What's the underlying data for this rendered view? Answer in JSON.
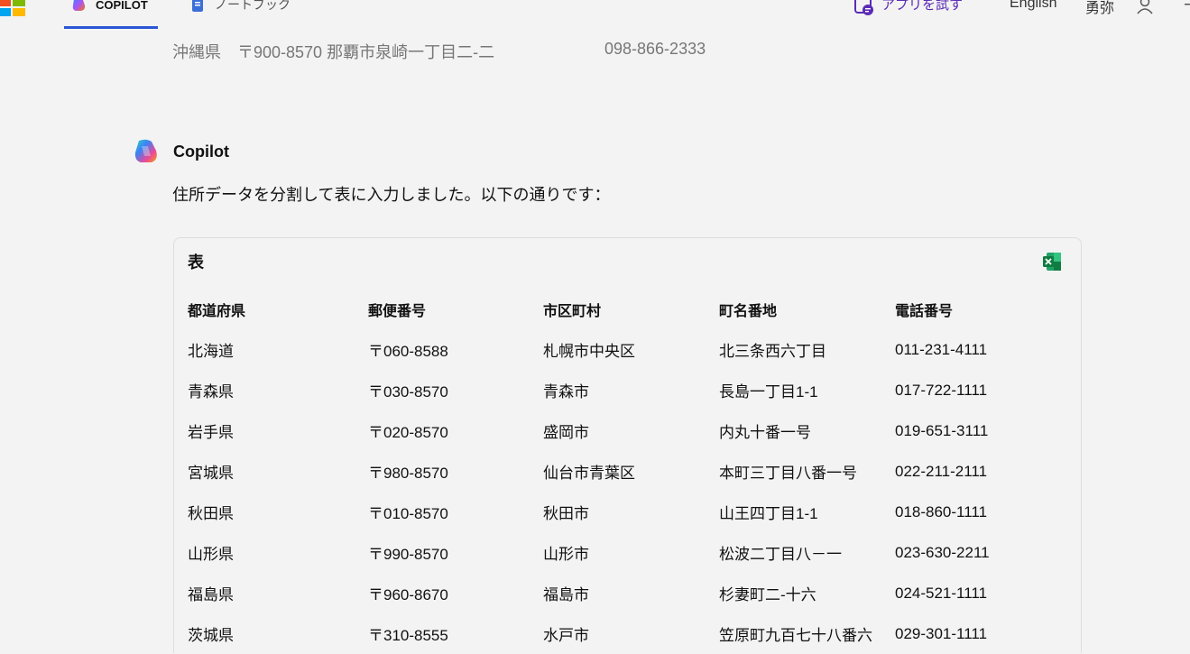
{
  "header": {
    "tabs": [
      {
        "label": "COPILOT",
        "icon": "copilot-icon",
        "active": true
      },
      {
        "label": "ノートブック",
        "icon": "notebook-icon",
        "active": false
      }
    ],
    "try_app_label": "アプリを試す",
    "language_label": "English",
    "user_name": "勇弥",
    "accent_color": "#2b57d6"
  },
  "previous_message": {
    "address": "沖縄県　〒900-8570 那覇市泉崎一丁目二-二",
    "phone": "098-866-2333"
  },
  "response": {
    "author": "Copilot",
    "intro": "住所データを分割して表に入力しました。以下の通りです：",
    "table_title": "表",
    "columns": [
      "都道府県",
      "郵便番号",
      "市区町村",
      "町名番地",
      "電話番号"
    ],
    "rows": [
      [
        "北海道",
        "〒060-8588",
        "札幌市中央区",
        "北三条西六丁目",
        "011-231-4111"
      ],
      [
        "青森県",
        "〒030-8570",
        "青森市",
        "長島一丁目1-1",
        "017-722-1111"
      ],
      [
        "岩手県",
        "〒020-8570",
        "盛岡市",
        "内丸十番一号",
        "019-651-3111"
      ],
      [
        "宮城県",
        "〒980-8570",
        "仙台市青葉区",
        "本町三丁目八番一号",
        "022-211-2111"
      ],
      [
        "秋田県",
        "〒010-8570",
        "秋田市",
        "山王四丁目1-1",
        "018-860-1111"
      ],
      [
        "山形県",
        "〒990-8570",
        "山形市",
        "松波二丁目八－一",
        "023-630-2211"
      ],
      [
        "福島県",
        "〒960-8670",
        "福島市",
        "杉妻町二-十六",
        "024-521-1111"
      ],
      [
        "茨城県",
        "〒310-8555",
        "水戸市",
        "笠原町九百七十八番六",
        "029-301-1111"
      ]
    ]
  }
}
